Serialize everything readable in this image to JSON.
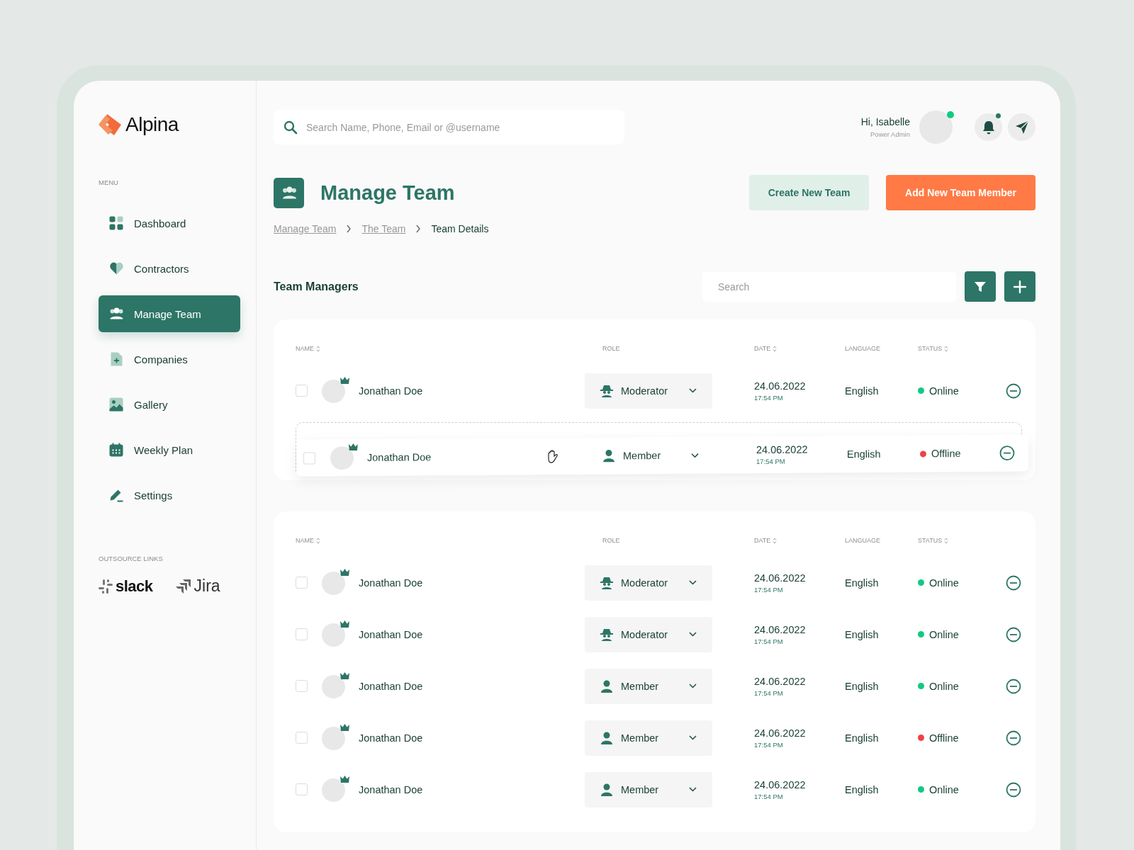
{
  "brand": "Alpina",
  "sidebar": {
    "menu_label": "MENU",
    "items": [
      {
        "kind": "dashboard",
        "label": "Dashboard",
        "selected": false
      },
      {
        "kind": "contractors",
        "label": "Contractors",
        "selected": false
      },
      {
        "kind": "team",
        "label": "Manage Team",
        "selected": true
      },
      {
        "kind": "companies",
        "label": "Companies",
        "selected": false
      },
      {
        "kind": "gallery",
        "label": "Gallery",
        "selected": false
      },
      {
        "kind": "plan",
        "label": "Weekly Plan",
        "selected": false
      },
      {
        "kind": "settings",
        "label": "Settings",
        "selected": false
      }
    ],
    "links_label": "OUTSOURCE LINKS",
    "links": [
      {
        "kind": "slack",
        "label": "slack"
      },
      {
        "kind": "jira",
        "label": "Jira"
      }
    ]
  },
  "search": {
    "placeholder": "Search Name, Phone, Email or @username"
  },
  "user": {
    "greeting": "Hi, Isabelle",
    "role": "Power Admin"
  },
  "page": {
    "title": "Manage Team",
    "buttons": [
      {
        "kind": "secondary",
        "label": "Create New Team"
      },
      {
        "kind": "primary",
        "label": "Add New Team Member"
      }
    ]
  },
  "breadcrumb": [
    {
      "label": "Manage Team",
      "current": false
    },
    {
      "label": "The Team",
      "current": false
    },
    {
      "label": "Team Details",
      "current": true
    }
  ],
  "section": {
    "title": "Team Managers",
    "search_placeholder": "Search"
  },
  "tables": [
    {
      "columns": [
        {
          "label": "NAME",
          "sortable": true
        },
        {
          "label": "ROLE",
          "sortable": false
        },
        {
          "label": "DATE",
          "sortable": true
        },
        {
          "label": "LANGUAGE",
          "sortable": false
        },
        {
          "label": "STATUS",
          "sortable": true
        }
      ],
      "rows": [
        {
          "name": "Jonathan Doe",
          "checked": false,
          "dragging": false,
          "role": {
            "kind": "moderator",
            "label": "Moderator"
          },
          "date": "24.06.2022",
          "time": "17:54 PM",
          "language": "English",
          "status": {
            "label": "Online",
            "color": "#12c982"
          }
        },
        {
          "name": "Jonathan Doe",
          "checked": false,
          "dragging": true,
          "role": {
            "kind": "member",
            "label": "Member"
          },
          "date": "24.06.2022",
          "time": "17:54 PM",
          "language": "English",
          "status": {
            "label": "Offline",
            "color": "#f0404a"
          }
        }
      ]
    },
    {
      "columns": [
        {
          "label": "NAME",
          "sortable": true
        },
        {
          "label": "ROLE",
          "sortable": false
        },
        {
          "label": "DATE",
          "sortable": true
        },
        {
          "label": "LANGUAGE",
          "sortable": false
        },
        {
          "label": "STATUS",
          "sortable": true
        }
      ],
      "rows": [
        {
          "name": "Jonathan Doe",
          "checked": false,
          "dragging": false,
          "role": {
            "kind": "moderator",
            "label": "Moderator"
          },
          "date": "24.06.2022",
          "time": "17:54 PM",
          "language": "English",
          "status": {
            "label": "Online",
            "color": "#12c982"
          }
        },
        {
          "name": "Jonathan Doe",
          "checked": false,
          "dragging": false,
          "role": {
            "kind": "moderator",
            "label": "Moderator"
          },
          "date": "24.06.2022",
          "time": "17:54 PM",
          "language": "English",
          "status": {
            "label": "Online",
            "color": "#12c982"
          }
        },
        {
          "name": "Jonathan Doe",
          "checked": false,
          "dragging": false,
          "role": {
            "kind": "member",
            "label": "Member"
          },
          "date": "24.06.2022",
          "time": "17:54 PM",
          "language": "English",
          "status": {
            "label": "Online",
            "color": "#12c982"
          }
        },
        {
          "name": "Jonathan Doe",
          "checked": false,
          "dragging": false,
          "role": {
            "kind": "member",
            "label": "Member"
          },
          "date": "24.06.2022",
          "time": "17:54 PM",
          "language": "English",
          "status": {
            "label": "Offline",
            "color": "#f0404a"
          }
        },
        {
          "name": "Jonathan Doe",
          "checked": false,
          "dragging": false,
          "role": {
            "kind": "member",
            "label": "Member"
          },
          "date": "24.06.2022",
          "time": "17:54 PM",
          "language": "English",
          "status": {
            "label": "Online",
            "color": "#12c982"
          }
        }
      ]
    }
  ]
}
